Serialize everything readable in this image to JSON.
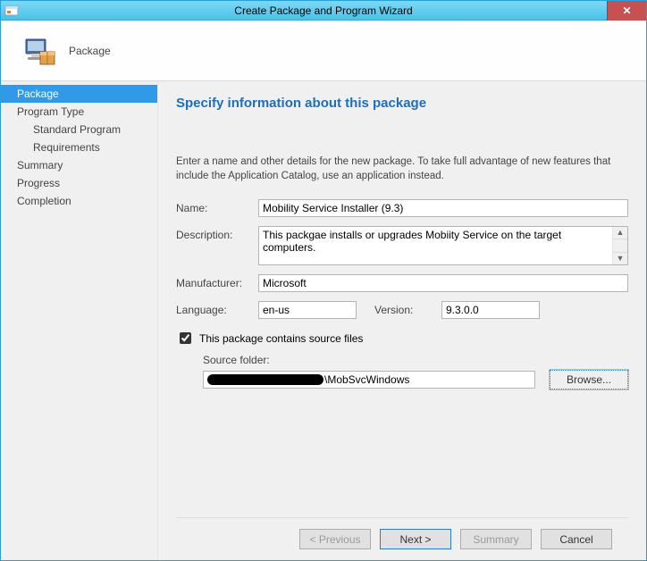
{
  "window": {
    "title": "Create Package and Program Wizard"
  },
  "header": {
    "heading": "Package"
  },
  "nav": {
    "items": [
      {
        "label": "Package",
        "selected": true,
        "sub": false
      },
      {
        "label": "Program Type",
        "selected": false,
        "sub": false
      },
      {
        "label": "Standard Program",
        "selected": false,
        "sub": true
      },
      {
        "label": "Requirements",
        "selected": false,
        "sub": true
      },
      {
        "label": "Summary",
        "selected": false,
        "sub": false
      },
      {
        "label": "Progress",
        "selected": false,
        "sub": false
      },
      {
        "label": "Completion",
        "selected": false,
        "sub": false
      }
    ]
  },
  "main": {
    "title": "Specify information about this package",
    "intro": "Enter a name and other details for the new package. To take full advantage of new features that include the Application Catalog, use an application instead.",
    "labels": {
      "name": "Name:",
      "description": "Description:",
      "manufacturer": "Manufacturer:",
      "language": "Language:",
      "version": "Version:",
      "containsSource": "This package contains source files",
      "sourceFolder": "Source folder:"
    },
    "fields": {
      "name": "Mobility Service Installer (9.3)",
      "description": "This packgae installs or upgrades Mobiity Service on the target computers.",
      "manufacturer": "Microsoft",
      "language": "en-us",
      "version": "9.3.0.0",
      "containsSource": true,
      "sourcePathVisibleSuffix": "\\MobSvcWindows"
    },
    "browse": "Browse..."
  },
  "buttons": {
    "previous": "< Previous",
    "next": "Next >",
    "summary": "Summary",
    "cancel": "Cancel"
  }
}
